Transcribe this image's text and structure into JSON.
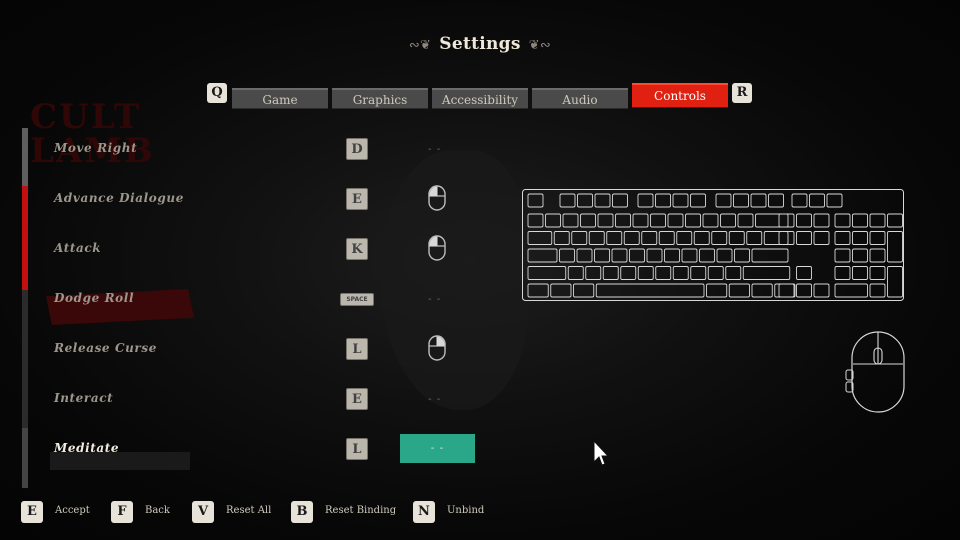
{
  "header": {
    "title": "Settings",
    "left_key": "Q",
    "right_key": "R"
  },
  "tabs": [
    {
      "label": "Game",
      "active": false
    },
    {
      "label": "Graphics",
      "active": false
    },
    {
      "label": "Accessibility",
      "active": false
    },
    {
      "label": "Audio",
      "active": false
    },
    {
      "label": "Controls",
      "active": true
    }
  ],
  "bindings": [
    {
      "action": "Move Right",
      "keyboard": "D",
      "mouse": "- -"
    },
    {
      "action": "Advance Dialogue",
      "keyboard": "E",
      "mouse_icon": "left-click-icon"
    },
    {
      "action": "Attack",
      "keyboard": "K",
      "mouse_icon": "left-click-icon"
    },
    {
      "action": "Dodge Roll",
      "keyboard": "SPACE",
      "mouse": "- -"
    },
    {
      "action": "Release Curse",
      "keyboard": "L",
      "mouse_icon": "right-click-icon"
    },
    {
      "action": "Interact",
      "keyboard": "E",
      "mouse": "- -"
    },
    {
      "action": "Meditate",
      "keyboard": "L",
      "mouse": "- -",
      "selected": true
    }
  ],
  "footer": [
    {
      "key": "E",
      "label": "Accept"
    },
    {
      "key": "F",
      "label": "Back"
    },
    {
      "key": "V",
      "label": "Reset All"
    },
    {
      "key": "B",
      "label": "Reset Binding"
    },
    {
      "key": "N",
      "label": "Unbind"
    }
  ],
  "colors": {
    "accent_red": "#e02010",
    "selected_teal": "#2aa789",
    "background": "#050505"
  },
  "icons": [
    "keyboard-diagram-icon",
    "mouse-diagram-icon",
    "pointer-cursor-icon"
  ]
}
